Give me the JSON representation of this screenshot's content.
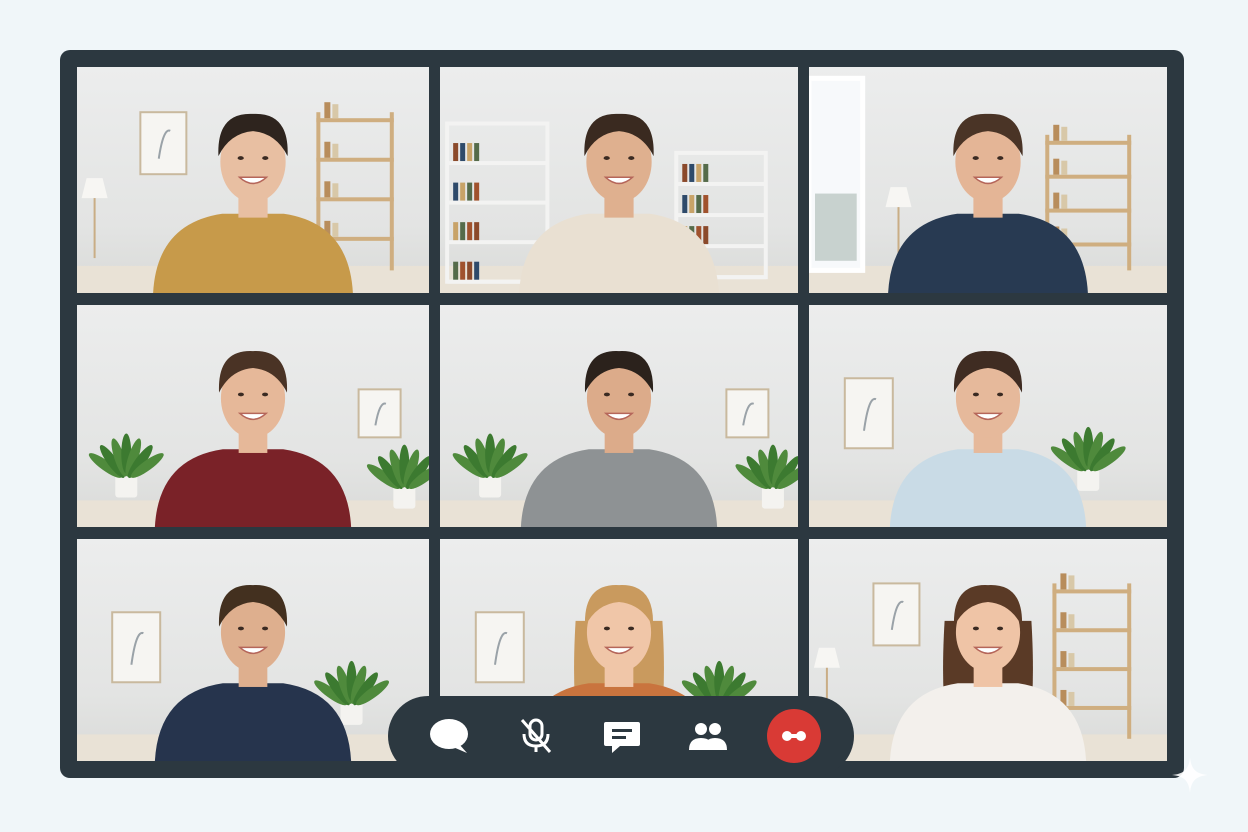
{
  "participants": [
    {
      "id": "p1",
      "skin": "#e8bfa2",
      "hair": "#2e241e",
      "shirt": "#c79a4a",
      "long_hair": false,
      "bun": true,
      "room": "shelf-right"
    },
    {
      "id": "p2",
      "skin": "#dfb08f",
      "hair": "#3a2a20",
      "shirt": "#e9e0d2",
      "long_hair": false,
      "bun": false,
      "room": "bookshelves"
    },
    {
      "id": "p3",
      "skin": "#e4b596",
      "hair": "#4a3426",
      "shirt": "#283a52",
      "long_hair": false,
      "bun": false,
      "room": "window"
    },
    {
      "id": "p4",
      "skin": "#e6b899",
      "hair": "#4a3325",
      "shirt": "#7a2228",
      "long_hair": false,
      "bun": false,
      "room": "plant-left"
    },
    {
      "id": "p5",
      "skin": "#dcab8a",
      "hair": "#2b221c",
      "shirt": "#8e9294",
      "long_hair": false,
      "bun": false,
      "room": "plant-left"
    },
    {
      "id": "p6",
      "skin": "#e6b99b",
      "hair": "#3f2c22",
      "shirt": "#c9dbe6",
      "long_hair": false,
      "bun": false,
      "room": "plant-right"
    },
    {
      "id": "p7",
      "skin": "#deaf8e",
      "hair": "#43301f",
      "shirt": "#26344d",
      "long_hair": false,
      "bun": false,
      "room": "plant-right"
    },
    {
      "id": "p8",
      "skin": "#f0c6a8",
      "hair": "#c99a5e",
      "shirt": "#c9743e",
      "long_hair": true,
      "bun": false,
      "room": "plant-right"
    },
    {
      "id": "p9",
      "skin": "#efc4a6",
      "hair": "#5a3a26",
      "shirt": "#f3f0ec",
      "long_hair": true,
      "bun": false,
      "room": "shelf-right"
    }
  ],
  "toolbar": {
    "buttons": [
      {
        "name": "chat-bubble-icon",
        "kind": "bubble"
      },
      {
        "name": "microphone-muted-icon",
        "kind": "mic-off"
      },
      {
        "name": "message-icon",
        "kind": "message"
      },
      {
        "name": "participants-icon",
        "kind": "people"
      },
      {
        "name": "end-call-icon",
        "kind": "end"
      }
    ],
    "end_color": "#d93a35"
  }
}
